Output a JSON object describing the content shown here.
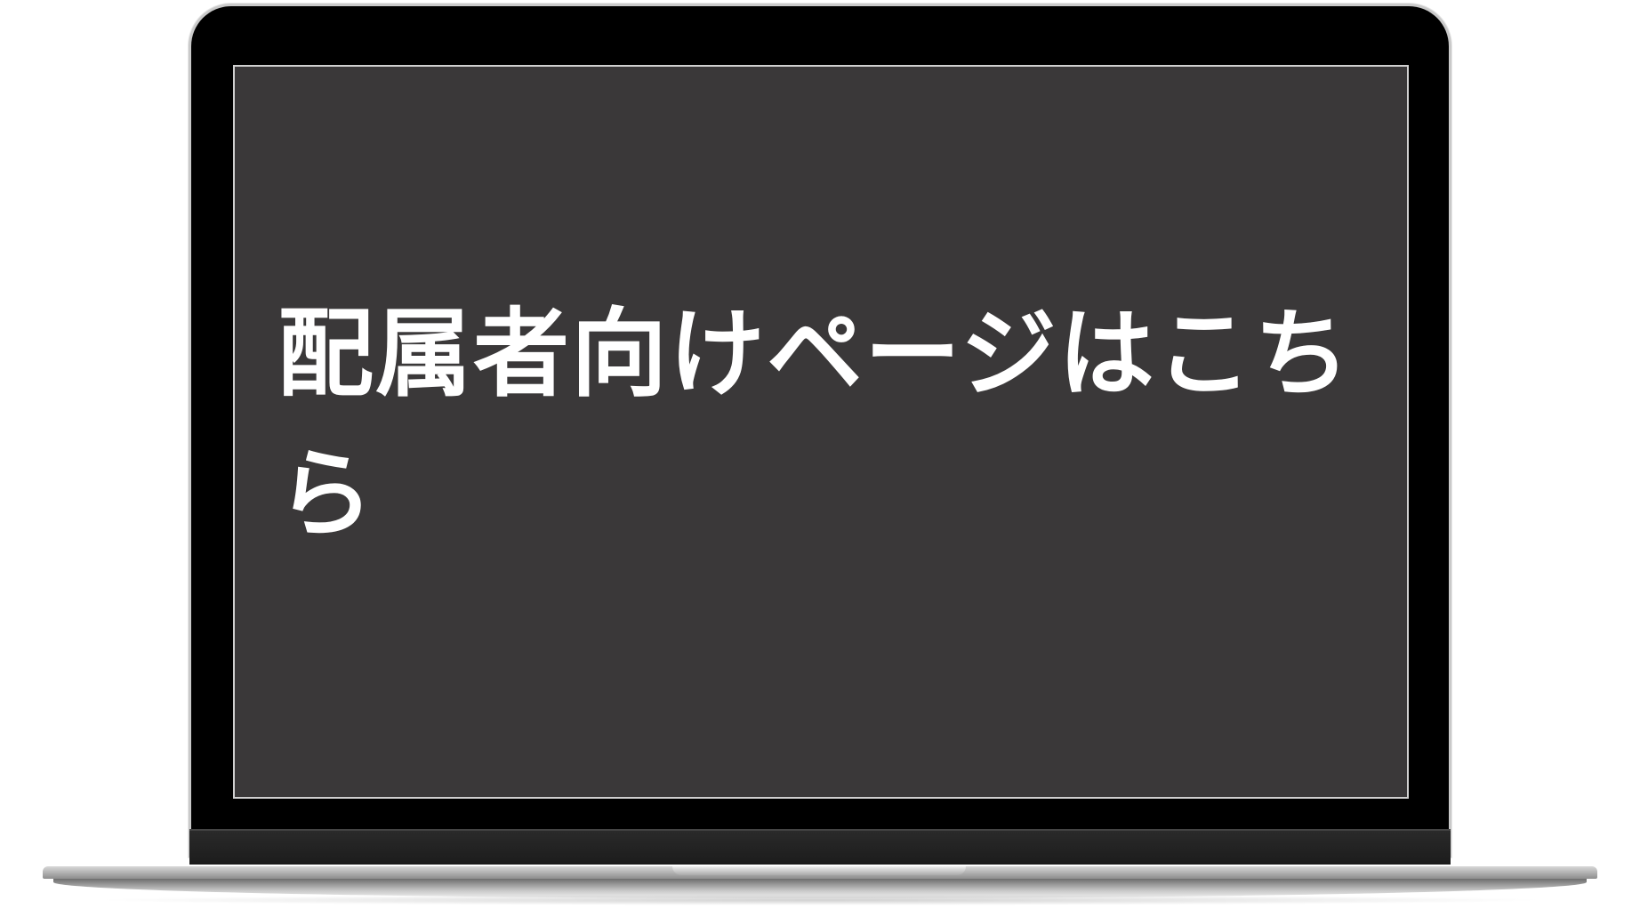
{
  "screen": {
    "text": "配属者向けページはこちら"
  },
  "colors": {
    "screen_background": "#3a3839",
    "screen_text": "#ffffff",
    "bezel": "#000000",
    "frame": "#c9c9c9"
  }
}
